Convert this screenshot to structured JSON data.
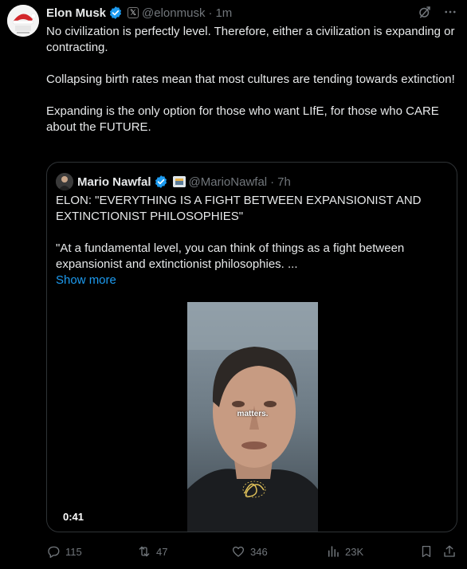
{
  "tweet": {
    "author_name": "Elon Musk",
    "affiliate_badge": "𝕏",
    "handle": "@elonmusk",
    "separator": "·",
    "time": "1m",
    "paragraphs": [
      "No civilization is perfectly level. Therefore, either a civilization is expanding or contracting.",
      "Collapsing  birth rates mean that most cultures are tending towards extinction!",
      "Expanding is the only option for those who want LIfE, for those who CARE about the FUTURE."
    ]
  },
  "quote": {
    "author_name": "Mario Nawfal",
    "handle": "@MarioNawfal",
    "separator": "·",
    "time": "7h",
    "paragraphs": [
      "ELON: \"EVERYTHING IS A FIGHT BETWEEN EXPANSIONIST AND EXTINCTIONIST PHILOSOPHIES\"",
      "\"At a fundamental level, you can think of things as a fight between expansionist and extinctionist philosophies. ..."
    ],
    "show_more": "Show more",
    "video": {
      "caption": "matters.",
      "duration": "0:41"
    }
  },
  "actions": {
    "replies": "115",
    "reposts": "47",
    "likes": "346",
    "views": "23K"
  },
  "colors": {
    "background": "#000000",
    "text": "#e7e9ea",
    "muted": "#71767b",
    "link": "#1d9bf0",
    "verified": "#1d9bf0",
    "border": "#2f3336"
  },
  "icons": [
    "verified-badge-icon",
    "x-affiliate-icon",
    "grok-icon",
    "more-icon",
    "reply-icon",
    "repost-icon",
    "like-icon",
    "views-icon",
    "bookmark-icon",
    "share-icon"
  ]
}
